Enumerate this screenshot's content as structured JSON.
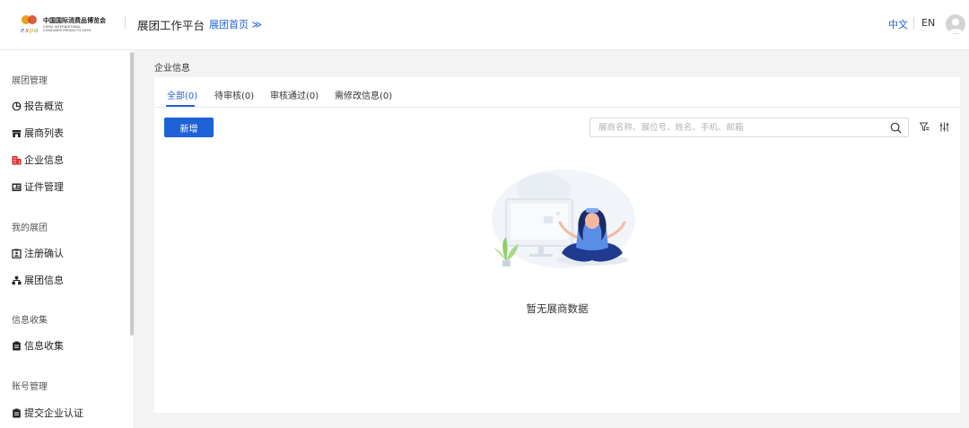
{
  "header": {
    "logo": {
      "cn": "中国国际消费品博览会",
      "en_line1": "CHINA INTERNATIONAL",
      "en_line2": "CONSUMER PRODUCTS EXPO"
    },
    "platform_title": "展团工作平台",
    "home_link": "展团首页 ≫",
    "lang_zh": "中文",
    "lang_en": "EN"
  },
  "sidebar": {
    "groups": [
      {
        "label": "展团管理",
        "items": [
          {
            "label": "报告概览",
            "icon": "pie-chart-icon"
          },
          {
            "label": "展商列表",
            "icon": "store-icon"
          },
          {
            "label": "企业信息",
            "icon": "building-icon",
            "active": true
          },
          {
            "label": "证件管理",
            "icon": "id-card-icon"
          }
        ]
      },
      {
        "label": "我的展团",
        "items": [
          {
            "label": "注册确认",
            "icon": "register-icon"
          },
          {
            "label": "展团信息",
            "icon": "org-chart-icon"
          }
        ]
      },
      {
        "label": "信息收集",
        "items": [
          {
            "label": "信息收集",
            "icon": "clipboard-icon"
          }
        ]
      },
      {
        "label": "账号管理",
        "items": [
          {
            "label": "提交企业认证",
            "icon": "clipboard-check-icon"
          }
        ]
      }
    ]
  },
  "main": {
    "breadcrumb": "企业信息",
    "tabs": [
      {
        "label": "全部(0)",
        "active": true
      },
      {
        "label": "待审核(0)"
      },
      {
        "label": "审核通过(0)"
      },
      {
        "label": "需修改信息(0)"
      }
    ],
    "add_button": "新增",
    "search_placeholder": "展商名称、展位号、姓名、手机、邮箱",
    "empty_text": "暂无展商数据"
  },
  "colors": {
    "accent": "#1e62d8",
    "active_icon": "#d9262c"
  }
}
